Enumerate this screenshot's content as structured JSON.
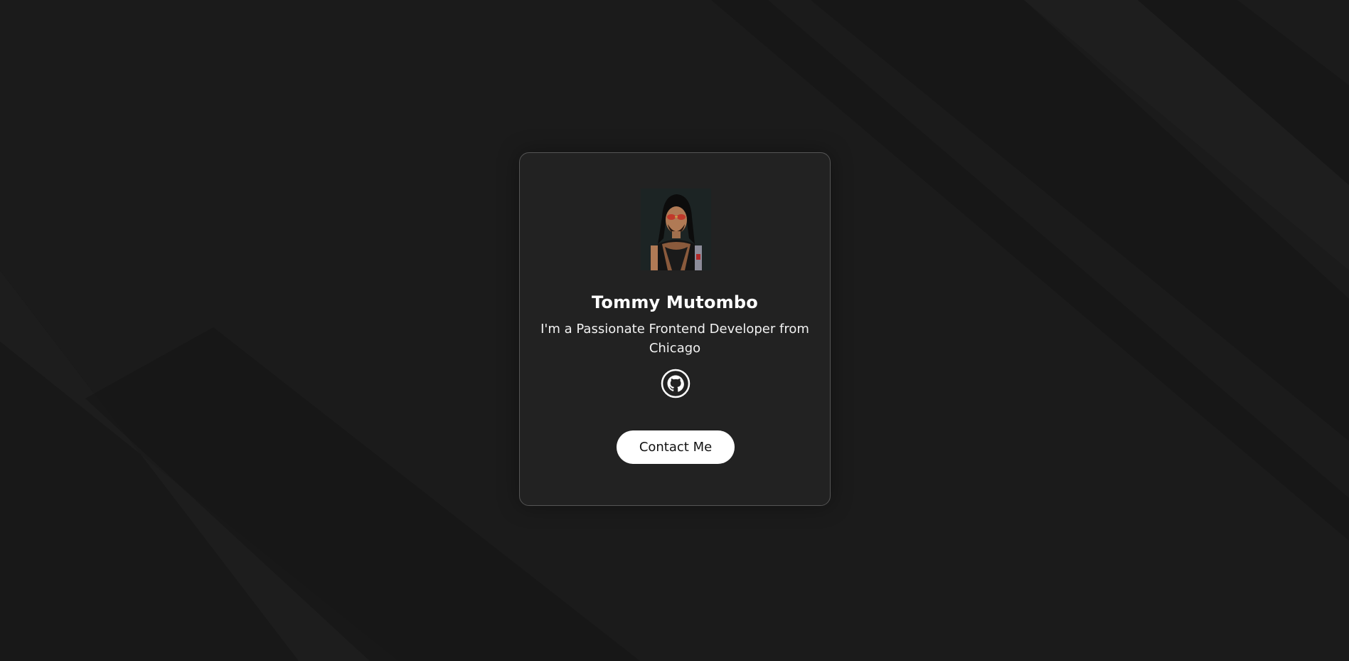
{
  "profile": {
    "name": "Tommy Mutombo",
    "bio": "I'm a Passionate Frontend Developer from Chicago",
    "avatar_icon": "portrait-avatar",
    "social": [
      {
        "icon": "github-icon"
      }
    ],
    "contact_label": "Contact Me"
  },
  "colors": {
    "background": "#1b1b1b",
    "card_background": "#222222",
    "card_border": "#555555",
    "button_background": "#ffffff",
    "text": "#ffffff"
  }
}
